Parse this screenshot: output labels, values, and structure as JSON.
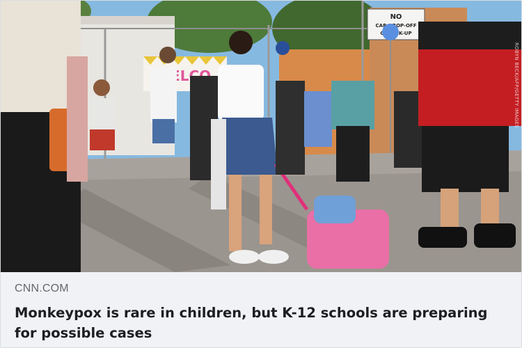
{
  "link_preview": {
    "domain": "CNN.COM",
    "headline": "Monkeypox is rare in children, but K-12 schools are preparing for possible cases",
    "image": {
      "sign_line1": "NO",
      "sign_line2": "CAR DROP-OFF",
      "sign_line3": "OR PICK-UP",
      "banner_text": "WELCO",
      "photo_credit": "ROBYN BECK/AFP/GETTY IMAGES"
    }
  },
  "colors": {
    "caption_background": "#f0f2f5",
    "domain_text": "#65676b",
    "headline_text": "#1c1e21",
    "sky": "#7fb3dd",
    "pavement": "#a8a29c"
  }
}
